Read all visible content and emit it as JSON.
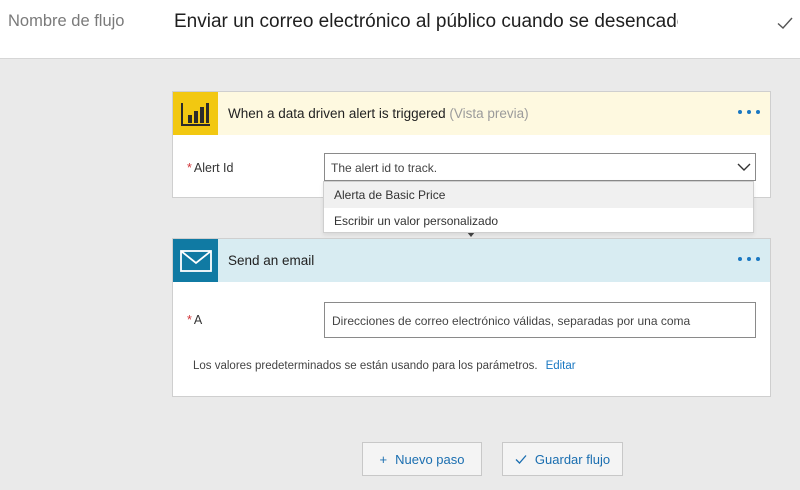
{
  "header": {
    "flow_name_label": "Nombre de flujo",
    "flow_name_value": "Enviar un correo electrónico al público cuando se desencadene"
  },
  "trigger_card": {
    "title": "When a data driven alert is triggered",
    "preview_label": "(Vista previa)",
    "icon": "power-bi-icon",
    "accent_color": "#f2c811",
    "field": {
      "label": "Alert Id",
      "required_mark": "*",
      "placeholder": "The alert id to track."
    },
    "dropdown_options": [
      "Alerta de Basic Price",
      "Escribir un valor personalizado"
    ]
  },
  "email_card": {
    "title": "Send an email",
    "icon": "mail-icon",
    "accent_color": "#107aa3",
    "field": {
      "label": "A",
      "required_mark": "*",
      "placeholder": "Direcciones de correo electrónico válidas, separadas por una coma"
    },
    "defaults_note": "Los valores predeterminados se están usando para los parámetros.",
    "edit_link": "Editar"
  },
  "footer": {
    "new_step_icon": "+",
    "new_step_label": "Nuevo paso",
    "save_label": "Guardar flujo"
  }
}
